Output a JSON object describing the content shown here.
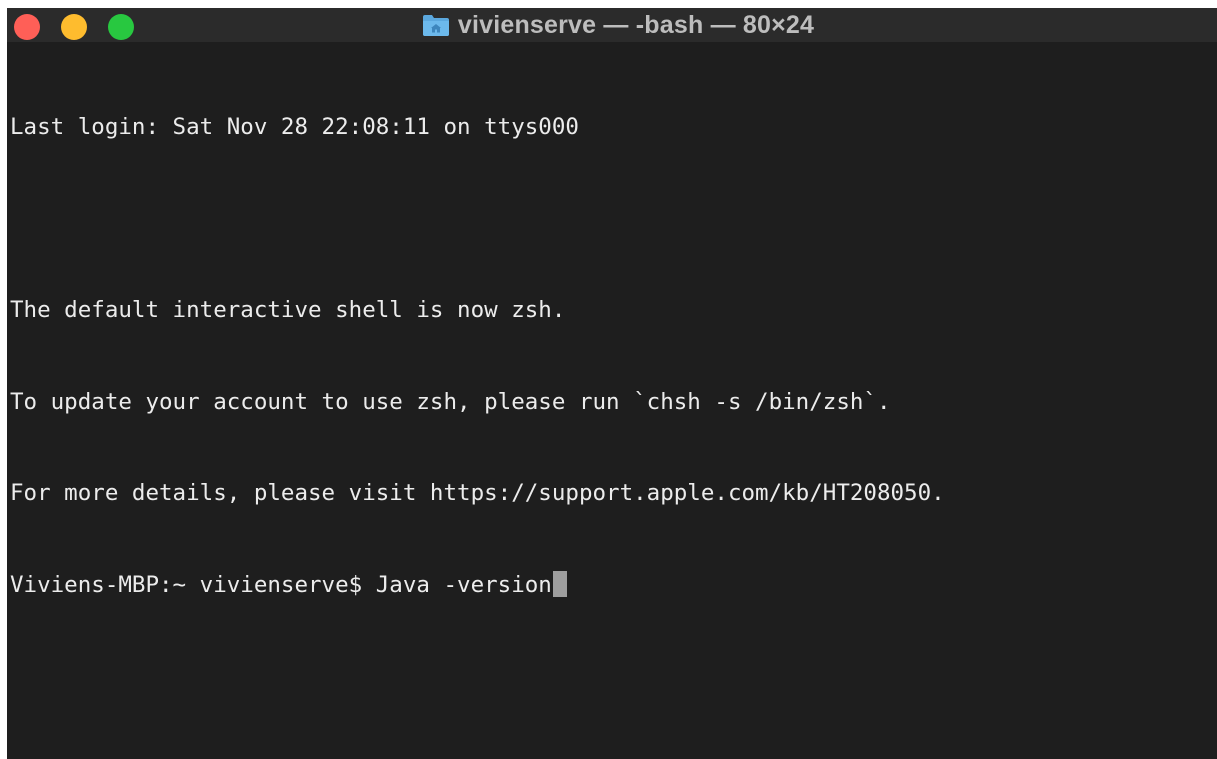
{
  "window": {
    "title": "vivienserve — -bash — 80×24",
    "title_icon": "home-folder-icon",
    "traffic_lights": {
      "close_color": "#ff5f57",
      "minimize_color": "#febc2e",
      "zoom_color": "#28c840"
    }
  },
  "terminal": {
    "lines": [
      "Last login: Sat Nov 28 22:08:11 on ttys000",
      "",
      "The default interactive shell is now zsh.",
      "To update your account to use zsh, please run `chsh -s /bin/zsh`.",
      "For more details, please visit https://support.apple.com/kb/HT208050."
    ],
    "prompt": "Viviens-MBP:~ vivienserve$ ",
    "current_input": "Java -version",
    "text_color": "#ececec",
    "background_color": "#1e1e1e",
    "cursor_color": "#9e9e9e"
  }
}
